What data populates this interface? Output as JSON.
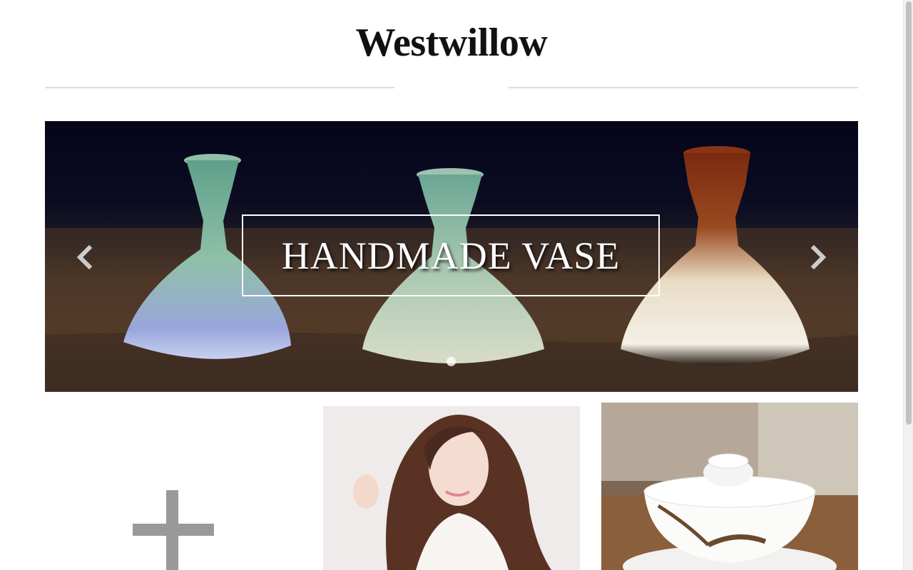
{
  "header": {
    "logo": "Westwillow"
  },
  "carousel": {
    "caption": "HANDMADE VASE",
    "prev_icon": "chevron-left-icon",
    "next_icon": "chevron-right-icon",
    "indicator_count": 1,
    "active_indicator": 1
  },
  "grid": {
    "tiles": [
      {
        "kind": "add",
        "icon": "plus-icon"
      },
      {
        "kind": "photo",
        "subject": "portrait"
      },
      {
        "kind": "photo",
        "subject": "teacup"
      }
    ]
  },
  "colors": {
    "logo": "#111111",
    "divider": "#dddddd",
    "plus_icon": "#999999",
    "caption": "#ffffff"
  }
}
